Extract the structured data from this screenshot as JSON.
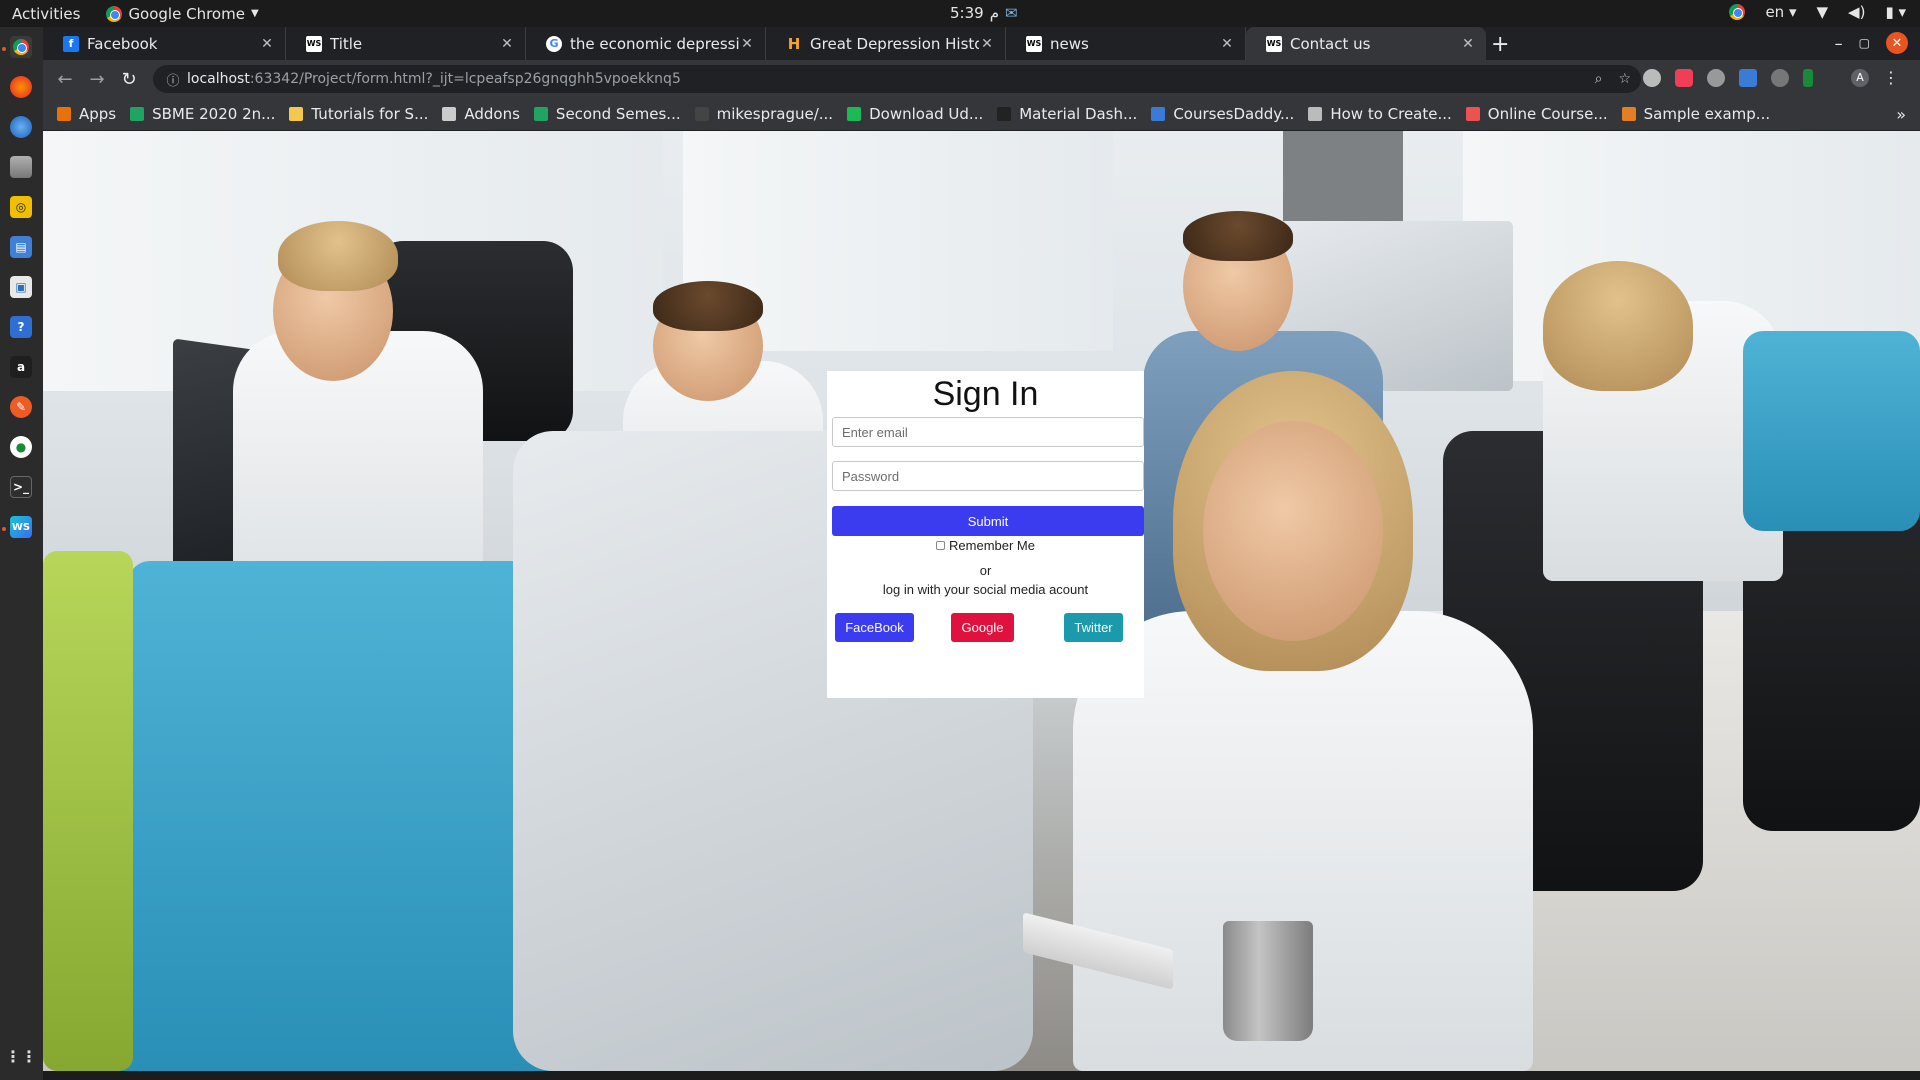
{
  "topbar": {
    "activities": "Activities",
    "app_name": "Google Chrome",
    "time": "5:39",
    "ampm": "م",
    "lang": "en"
  },
  "tabs": [
    {
      "title": "Facebook",
      "favicon": "facebook-icon",
      "fav_color": "#1877f2",
      "fav_char": "f"
    },
    {
      "title": "Title",
      "favicon": "webstorm-icon",
      "fav_color": "#ffffff",
      "fav_char": "WS"
    },
    {
      "title": "the economic depression",
      "favicon": "google-icon",
      "fav_color": "#ffffff",
      "fav_char": "G"
    },
    {
      "title": "Great Depression History",
      "favicon": "history-icon",
      "fav_color": "#f5a623",
      "fav_char": "H"
    },
    {
      "title": "news",
      "favicon": "webstorm-icon",
      "fav_color": "#ffffff",
      "fav_char": "WS"
    },
    {
      "title": "Contact us",
      "favicon": "webstorm-icon",
      "fav_color": "#ffffff",
      "fav_char": "WS"
    }
  ],
  "omnibox": {
    "host": "localhost",
    "path": ":63342/Project/form.html?_ijt=lcpeafsp26gnqghh5vpoekknq5"
  },
  "bookmarks": [
    {
      "label": "Apps",
      "icon": "apps-grid-icon",
      "color": "#e8710a"
    },
    {
      "label": "SBME 2020 2n...",
      "icon": "drive-icon",
      "color": "#1fa463"
    },
    {
      "label": "Tutorials for S...",
      "icon": "bookmark-icon",
      "color": "#f2c94c"
    },
    {
      "label": "Addons",
      "icon": "globe-icon",
      "color": "#cccccc"
    },
    {
      "label": "Second Semes...",
      "icon": "drive-icon",
      "color": "#1fa463"
    },
    {
      "label": "mikesprague/...",
      "icon": "github-icon",
      "color": "#444444"
    },
    {
      "label": "Download Ud...",
      "icon": "ftu-icon",
      "color": "#1db954"
    },
    {
      "label": "Material Dash...",
      "icon": "material-icon",
      "color": "#222222"
    },
    {
      "label": "CoursesDaddy...",
      "icon": "coursesdaddy-icon",
      "color": "#3a7bd5"
    },
    {
      "label": "How to Create...",
      "icon": "page-icon",
      "color": "#bbbbbb"
    },
    {
      "label": "Online Course...",
      "icon": "udemy-icon",
      "color": "#ec5252"
    },
    {
      "label": "Sample examp...",
      "icon": "sample-icon",
      "color": "#e67e22"
    }
  ],
  "form": {
    "title": "Sign In",
    "email_placeholder": "Enter email",
    "password_placeholder": "Password",
    "submit_label": "Submit",
    "remember_label": "Remember Me",
    "or_text": "or",
    "social_text": "log in with your social media acount",
    "facebook_label": "FaceBook",
    "google_label": "Google",
    "twitter_label": "Twitter",
    "colors": {
      "submit": "#3b3bf0",
      "facebook": "#3b3bf0",
      "google": "#e0103f",
      "twitter": "#1a9aaa"
    }
  }
}
